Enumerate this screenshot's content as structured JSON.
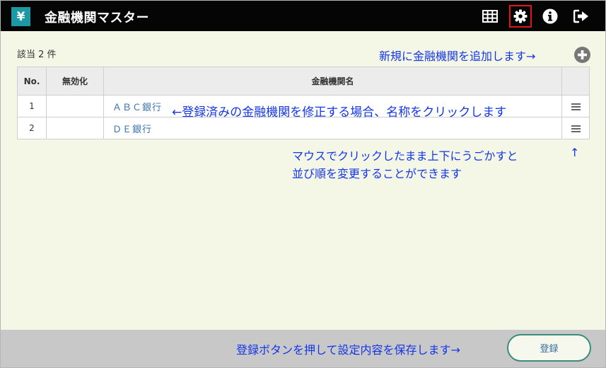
{
  "header": {
    "logo": "¥",
    "title": "金融機関マスター"
  },
  "summary": {
    "count_text": "該当 2 件"
  },
  "annotations": {
    "add_hint": "新規に金融機関を追加します→",
    "edit_hint": "←登録済みの金融機関を修正する場合、名称をクリックします",
    "reorder_line1": "マウスでクリックしたまま上下にうごかすと",
    "reorder_arrow": "↑",
    "reorder_line2": "並び順を変更することができます",
    "save_hint": "登録ボタンを押して設定内容を保存します→"
  },
  "table": {
    "headers": {
      "no": "No.",
      "disabled": "無効化",
      "name": "金融機関名",
      "menu": ""
    },
    "rows": [
      {
        "no": "1",
        "disabled": "",
        "name": "ＡＢＣ銀行"
      },
      {
        "no": "2",
        "disabled": "",
        "name": "ＤＥ銀行"
      }
    ]
  },
  "footer": {
    "save_label": "登録"
  },
  "colors": {
    "accent": "#1b9aa6",
    "annotation": "#1336e8",
    "highlight": "#e0141b"
  }
}
